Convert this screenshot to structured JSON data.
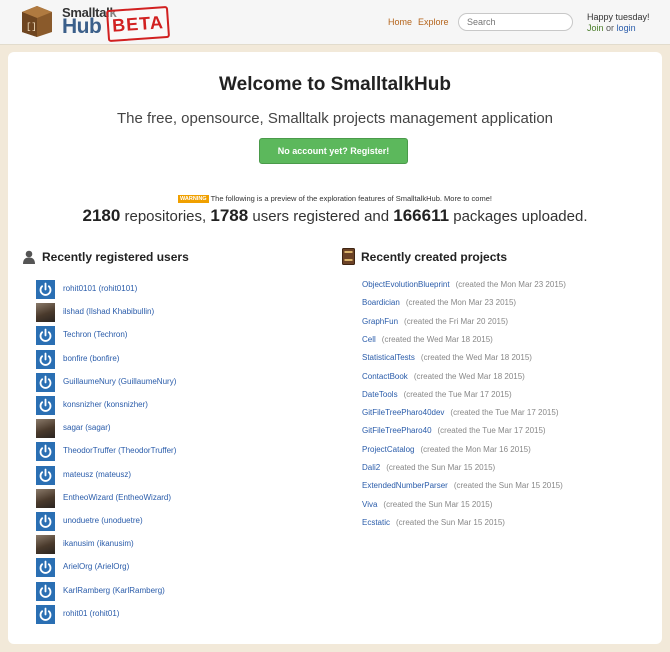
{
  "header": {
    "logo_top": "Smalltalk",
    "logo_bottom": "Hub",
    "beta": "BETA",
    "nav": [
      "Home",
      "Explore"
    ],
    "search_placeholder": "Search",
    "greeting": "Happy tuesday!",
    "join": "Join",
    "or": "or",
    "login": "login"
  },
  "main": {
    "title": "Welcome to SmalltalkHub",
    "subtitle": "The free, opensource, Smalltalk projects management application",
    "register_label": "No account yet? Register!",
    "warning_badge": "WARNING",
    "warning_text": "The following is a preview of the exploration features of SmalltalkHub. More to come!",
    "stats": {
      "repositories": "2180",
      "repositories_label": " repositories, ",
      "users": "1788",
      "users_label": " users registered and ",
      "packages": "166611",
      "packages_label": " packages uploaded."
    },
    "users_title": "Recently registered users",
    "projects_title": "Recently created projects",
    "users": [
      {
        "label": "rohit0101 (rohit0101)",
        "avatar": "power-icon"
      },
      {
        "label": "ilshad (Ilshad Khabibullin)",
        "avatar": "photo"
      },
      {
        "label": "Techron (Techron)",
        "avatar": "power-icon"
      },
      {
        "label": "bonfire (bonfire)",
        "avatar": "power-icon"
      },
      {
        "label": "GuillaumeNury (GuillaumeNury)",
        "avatar": "power-icon"
      },
      {
        "label": "konsnizher (konsnizher)",
        "avatar": "power-icon"
      },
      {
        "label": "sagar (sagar)",
        "avatar": "photo"
      },
      {
        "label": "TheodorTruffer (TheodorTruffer)",
        "avatar": "power-icon"
      },
      {
        "label": "mateusz (mateusz)",
        "avatar": "power-icon"
      },
      {
        "label": "EntheoWizard (EntheoWizard)",
        "avatar": "photo"
      },
      {
        "label": "unoduetre (unoduetre)",
        "avatar": "power-icon"
      },
      {
        "label": "ikanusim (ikanusim)",
        "avatar": "photo"
      },
      {
        "label": "ArielOrg (ArielOrg)",
        "avatar": "power-icon"
      },
      {
        "label": "KarlRamberg (KarlRamberg)",
        "avatar": "power-icon"
      },
      {
        "label": "rohit01 (rohit01)",
        "avatar": "power-icon"
      }
    ],
    "projects": [
      {
        "name": "ObjectEvolutionBlueprint",
        "date": "(created the Mon Mar 23 2015)"
      },
      {
        "name": "Boardician",
        "date": "(created the Mon Mar 23 2015)"
      },
      {
        "name": "GraphFun",
        "date": "(created the Fri Mar 20 2015)"
      },
      {
        "name": "Cell",
        "date": "(created the Wed Mar 18 2015)"
      },
      {
        "name": "StatisticalTests",
        "date": "(created the Wed Mar 18 2015)"
      },
      {
        "name": "ContactBook",
        "date": "(created the Wed Mar 18 2015)"
      },
      {
        "name": "DateTools",
        "date": "(created the Tue Mar 17 2015)"
      },
      {
        "name": "GitFileTreePharo40dev",
        "date": "(created the Tue Mar 17 2015)"
      },
      {
        "name": "GitFileTreePharo40",
        "date": "(created the Tue Mar 17 2015)"
      },
      {
        "name": "ProjectCatalog",
        "date": "(created the Mon Mar 16 2015)"
      },
      {
        "name": "Dali2",
        "date": "(created the Sun Mar 15 2015)"
      },
      {
        "name": "ExtendedNumberParser",
        "date": "(created the Sun Mar 15 2015)"
      },
      {
        "name": "Viva",
        "date": "(created the Sun Mar 15 2015)"
      },
      {
        "name": "Ecstatic",
        "date": "(created the Sun Mar 15 2015)"
      }
    ]
  },
  "colors": {
    "background": "#f2e9d9",
    "link": "#2a5caa",
    "nav": "#b5651d",
    "register": "#5cb85c",
    "avatar_blue": "#2a6fb3",
    "beta_red": "#d12020"
  }
}
